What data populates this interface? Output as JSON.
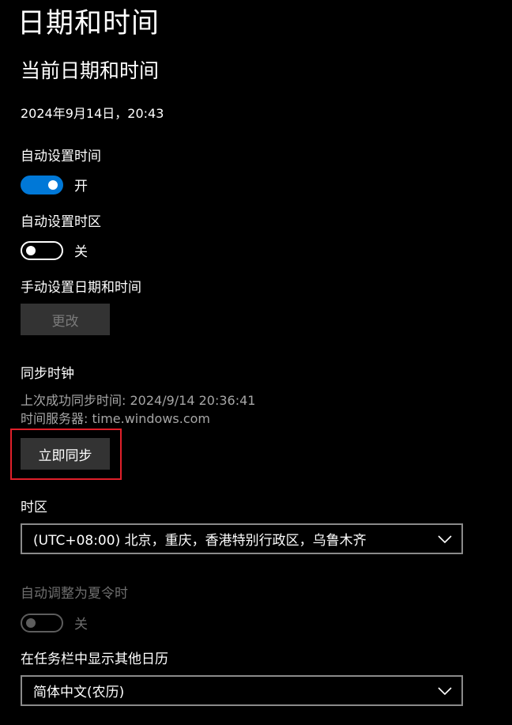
{
  "page": {
    "title": "日期和时间"
  },
  "current": {
    "heading": "当前日期和时间",
    "datetime": "2024年9月14日，20:43"
  },
  "auto_time": {
    "label": "自动设置时间",
    "state_text": "开",
    "on": true
  },
  "auto_timezone": {
    "label": "自动设置时区",
    "state_text": "关",
    "on": false
  },
  "manual": {
    "label": "手动设置日期和时间",
    "button": "更改"
  },
  "sync": {
    "heading": "同步时钟",
    "last_sync": "上次成功同步时间: 2024/9/14 20:36:41",
    "server": "时间服务器: time.windows.com",
    "button": "立即同步"
  },
  "timezone": {
    "label": "时区",
    "selected": "(UTC+08:00) 北京，重庆，香港特别行政区，乌鲁木齐"
  },
  "dst": {
    "label": "自动调整为夏令时",
    "state_text": "关",
    "on": false,
    "enabled": false
  },
  "calendar": {
    "label": "在任务栏中显示其他日历",
    "selected": "简体中文(农历)"
  },
  "colors": {
    "accent": "#0078d7",
    "highlight": "#e0202a"
  }
}
